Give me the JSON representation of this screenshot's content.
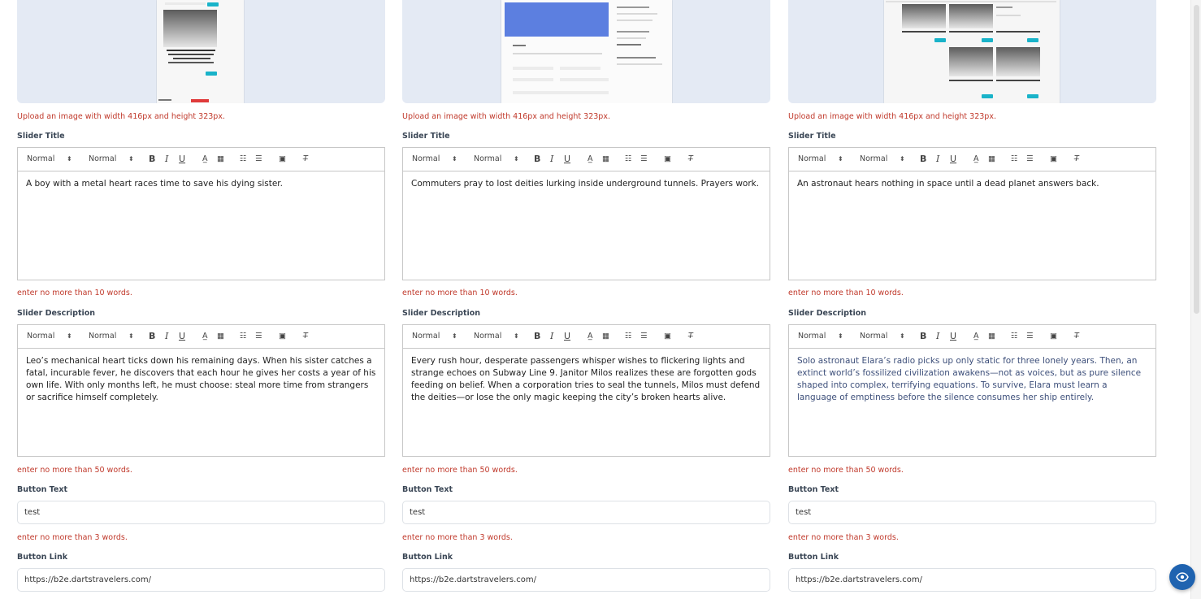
{
  "colors": {
    "hint": "#c0392b",
    "label": "#3a4655",
    "image_placeholder": "#e4eaf4",
    "fab": "#1f63b0"
  },
  "toolbar": {
    "header_select": "Normal",
    "size_select": "Normal",
    "icons": [
      "bold-icon",
      "italic-icon",
      "underline-icon",
      "text-color-icon",
      "background-color-icon",
      "ordered-list-icon",
      "bullet-list-icon",
      "image-icon",
      "clear-format-icon"
    ],
    "bold": "B",
    "italic": "I",
    "underline": "U"
  },
  "labels": {
    "upload_hint": "Upload an image with width 416px and height 323px.",
    "slider_title": "Slider Title",
    "title_hint": "enter no more than 10 words.",
    "slider_description": "Slider Description",
    "description_hint": "enter no more than 50 words.",
    "button_text": "Button Text",
    "button_text_hint": "enter no more than 3 words.",
    "button_link": "Button Link"
  },
  "slides": [
    {
      "title": "A boy with a metal heart races time to save his dying sister.",
      "description": "Leo’s mechanical heart ticks down his remaining days. When his sister catches a fatal, incurable fever, he discovers that each hour he gives her costs a year of his own life. With only months left, he must choose: steal more time from strangers or sacrifice himself completely.",
      "button_text": "test",
      "button_link": "https://b2e.dartstravelers.com/"
    },
    {
      "title": "Commuters pray to lost deities lurking inside underground tunnels. Prayers work.",
      "description": "Every rush hour, desperate passengers whisper wishes to flickering lights and strange echoes on Subway Line 9. Janitor Milos realizes these are forgotten gods feeding on belief. When a corporation tries to seal the tunnels, Milos must defend the deities—or lose the only magic keeping the city’s broken hearts alive.",
      "button_text": "test",
      "button_link": "https://b2e.dartstravelers.com/"
    },
    {
      "title": "An astronaut hears nothing in space until a dead planet answers back.",
      "description": "Solo astronaut Elara’s radio picks up only static for three lonely years. Then, an extinct world’s fossilized civilization awakens—not as voices, but as pure silence shaped into complex, terrifying equations. To survive, Elara must learn a language of emptiness before the silence consumes her ship entirely.",
      "button_text": "test",
      "button_link": "https://b2e.dartstravelers.com/"
    }
  ],
  "fab_icon": "eye-icon"
}
